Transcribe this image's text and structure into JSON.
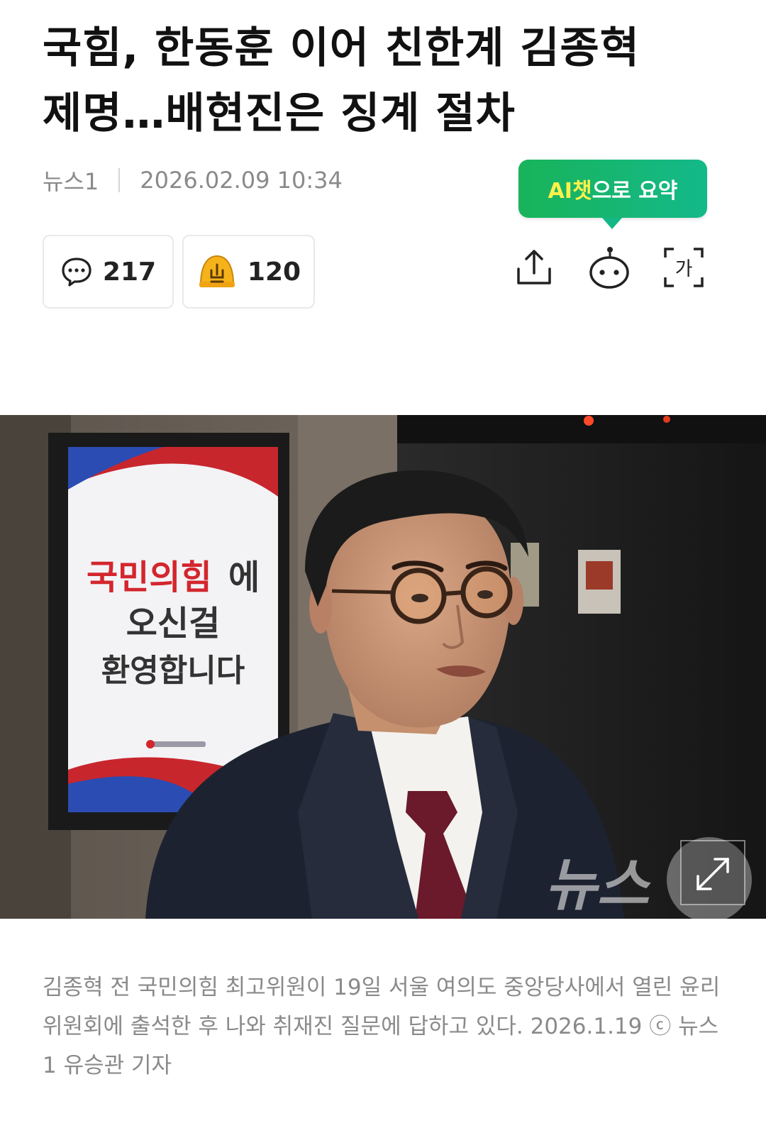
{
  "article": {
    "title_line1": "국힘, 한동훈 이어 친한계 김종혁",
    "title_line2": "제명…배현진은 징계 절차",
    "source": "뉴스1",
    "datetime": "2026.02.09 10:34"
  },
  "ai_summary": {
    "highlight": "AI챗",
    "rest": "으로 요약"
  },
  "reactions": {
    "comment_count": "217",
    "reaction_count": "120"
  },
  "toolbar": {
    "share_icon": "share-icon",
    "bot_icon": "ai-bot-icon",
    "font_size_icon": "font-size-icon",
    "font_size_glyph": "가"
  },
  "photo": {
    "sign_line1": "국민의힘",
    "sign_line1_suffix": "에",
    "sign_line2": "오신걸",
    "sign_line3": "환영합니다",
    "watermark": "뉴스",
    "expand_icon": "expand-icon"
  },
  "caption": {
    "text": "김종혁 전 국민의힘 최고위원이 19일 서울 여의도 중앙당사에서 열린 윤리위원회에 출석한 후 나와 취재진 질문에 답하고 있다. 2026.1.19 ⓒ 뉴스1 유승관 기자"
  },
  "colors": {
    "ai_green": "#18b35a",
    "ai_highlight": "#fff04a",
    "meta_gray": "#8a8a8a"
  }
}
